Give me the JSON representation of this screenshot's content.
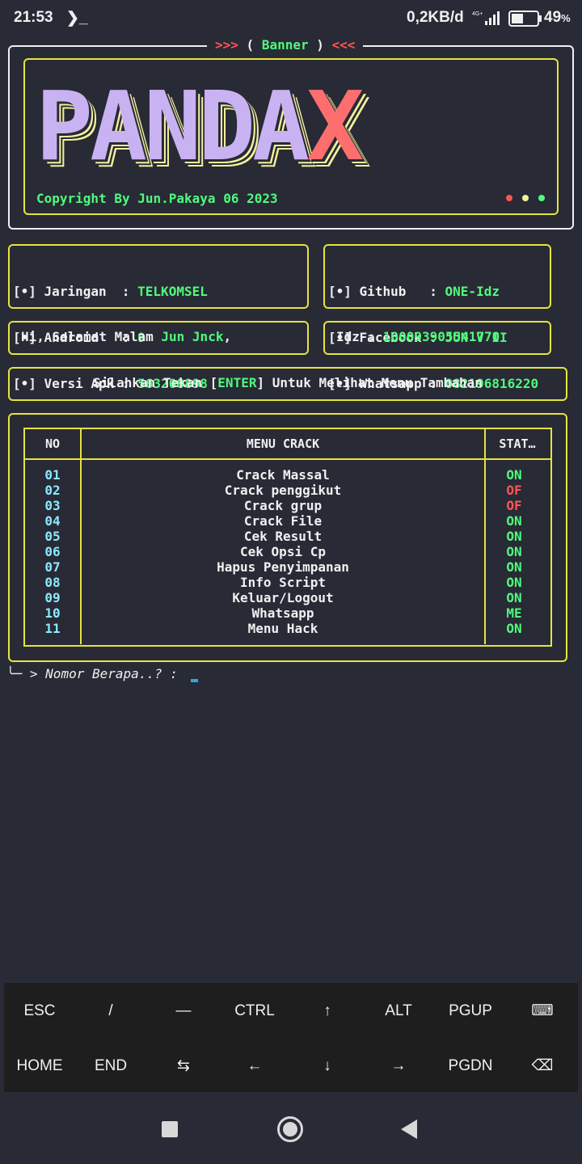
{
  "status_bar": {
    "time": "21:53",
    "terminal_glyph": "❯_",
    "net_speed": "0,2KB/d",
    "signal": "4G+",
    "battery_pct": "49",
    "battery_unit": "%"
  },
  "banner": {
    "title_left": ">>>",
    "title_open": " ( ",
    "title_text": "Banner",
    "title_close": " ) ",
    "title_right": "<<<",
    "logo_main": "PANDA",
    "logo_accent": "X",
    "copyright": "Copyright By Jun.Pakaya 06 2023"
  },
  "device_info": {
    "bullet": "[•]",
    "rows": [
      {
        "label": "Jaringan  ",
        "sep": ":",
        "value": "TELKOMSEL"
      },
      {
        "label": "Android   ",
        "sep": ":",
        "value": "9"
      },
      {
        "label": "Versi Apk ",
        "sep": ":",
        "value": "563208898"
      }
    ]
  },
  "contact_info": {
    "rows": [
      {
        "label": "Github   ",
        "sep": ":",
        "value": "ONE-Idz"
      },
      {
        "label": "Facebook ",
        "sep": ":",
        "value": "JUN V II"
      },
      {
        "label": "Whatsapp ",
        "sep": ":",
        "value": "082196816220"
      }
    ]
  },
  "greeting": {
    "text": "Hi, Selamat Malam ",
    "name": "Jun Jnck",
    "suffix": ","
  },
  "idz": {
    "label": "Idz : ",
    "value": "100093905541770"
  },
  "enter_hint": {
    "before": "Silahkan Tekan [",
    "key": "ENTER",
    "after": "] Untuk Melihat Menu Tambahan"
  },
  "menu": {
    "headers": {
      "no": "NO",
      "menu": "MENU CRACK",
      "status": "STAT…"
    },
    "rows": [
      {
        "no": "01",
        "name": "Crack Massal",
        "status": "ON"
      },
      {
        "no": "02",
        "name": "Crack penggikut",
        "status": "OF"
      },
      {
        "no": "03",
        "name": "Crack grup",
        "status": "OF"
      },
      {
        "no": "04",
        "name": "Crack File",
        "status": "ON"
      },
      {
        "no": "05",
        "name": "Cek Result",
        "status": "ON"
      },
      {
        "no": "06",
        "name": "Cek Opsi Cp",
        "status": "ON"
      },
      {
        "no": "07",
        "name": "Hapus Penyimpanan",
        "status": "ON"
      },
      {
        "no": "08",
        "name": "Info Script",
        "status": "ON"
      },
      {
        "no": "09",
        "name": "Keluar/Logout",
        "status": "ON"
      },
      {
        "no": "10",
        "name": "Whatsapp",
        "status": "ME"
      },
      {
        "no": "11",
        "name": "Menu Hack",
        "status": "ON"
      }
    ]
  },
  "prompt": {
    "corner": "╰─",
    "text": "> Nomor Berapa..? :"
  },
  "extra_keys": {
    "row1": [
      "ESC",
      "/",
      "—",
      "CTRL",
      "↑",
      "ALT",
      "PGUP",
      "⌨"
    ],
    "row2": [
      "HOME",
      "END",
      "⇆",
      "←",
      "↓",
      "→",
      "PGDN",
      "⌫"
    ]
  },
  "colors": {
    "background": "#282a36",
    "yellow_border": "#e6e43c",
    "green": "#50fa7b",
    "red": "#ff5555",
    "cyan": "#8be9fd",
    "logo_purple": "#c9b2f2",
    "logo_red": "#ff6e6e"
  }
}
